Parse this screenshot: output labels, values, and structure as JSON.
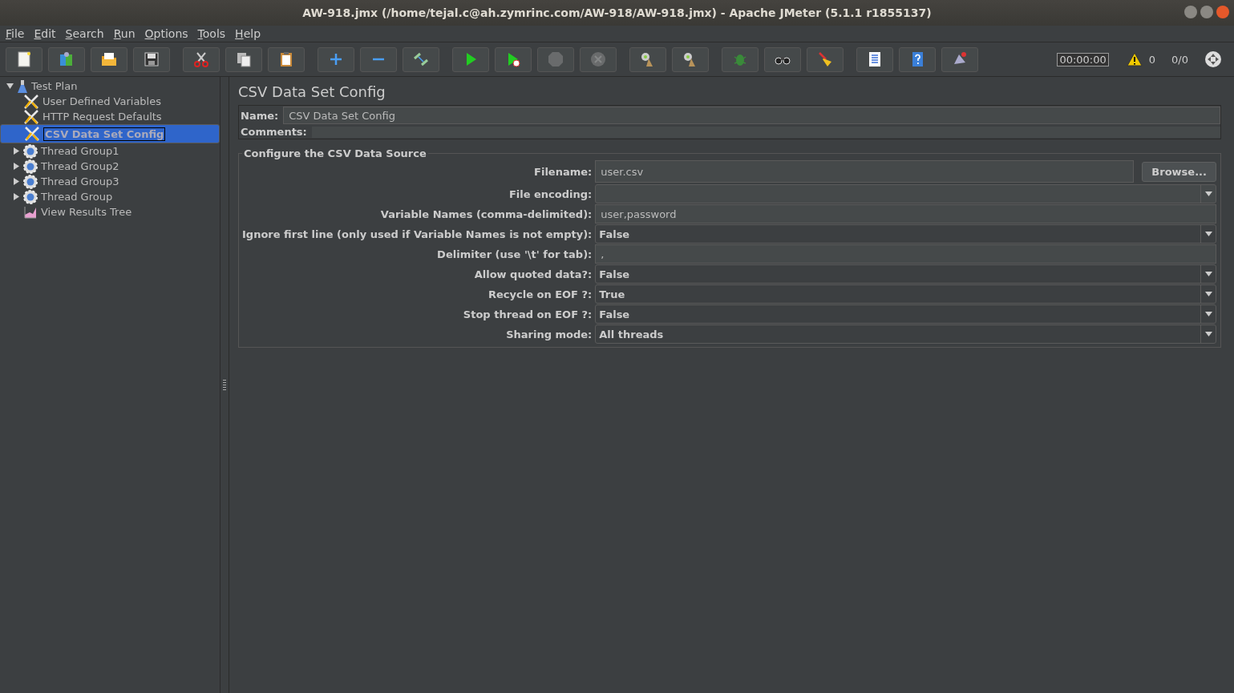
{
  "window": {
    "title": "AW-918.jmx (/home/tejal.c@ah.zymrinc.com/AW-918/AW-918.jmx) - Apache JMeter (5.1.1 r1855137)"
  },
  "menu": [
    "File",
    "Edit",
    "Search",
    "Run",
    "Options",
    "Tools",
    "Help"
  ],
  "toolbar": [
    [
      {
        "kind": "new",
        "disabled": false
      },
      {
        "kind": "templates",
        "disabled": false
      },
      {
        "kind": "open",
        "disabled": false
      },
      {
        "kind": "save",
        "disabled": false
      }
    ],
    [
      {
        "kind": "cut",
        "disabled": false
      },
      {
        "kind": "copy",
        "disabled": false
      },
      {
        "kind": "paste",
        "disabled": false
      }
    ],
    [
      {
        "kind": "plus",
        "disabled": false
      },
      {
        "kind": "minus",
        "disabled": false
      },
      {
        "kind": "toggle",
        "disabled": false
      }
    ],
    [
      {
        "kind": "start",
        "disabled": false
      },
      {
        "kind": "start-nopause",
        "disabled": false
      },
      {
        "kind": "stop",
        "disabled": true
      },
      {
        "kind": "shutdown",
        "disabled": true
      }
    ],
    [
      {
        "kind": "clear",
        "disabled": false
      },
      {
        "kind": "clear-all",
        "disabled": false
      }
    ],
    [
      {
        "kind": "bug",
        "disabled": false
      },
      {
        "kind": "binoculars",
        "disabled": false
      },
      {
        "kind": "broom",
        "disabled": false
      }
    ],
    [
      {
        "kind": "list",
        "disabled": false
      },
      {
        "kind": "help",
        "disabled": false
      },
      {
        "kind": "remote",
        "disabled": false
      }
    ]
  ],
  "status": {
    "timer": "00:00:00",
    "warnings": "0",
    "threads": "0/0"
  },
  "tree": [
    {
      "label": "Test Plan",
      "kind": "plan",
      "expanded": true,
      "selected": false,
      "children": [
        {
          "label": "User Defined Variables",
          "kind": "config",
          "selected": false
        },
        {
          "label": "HTTP Request Defaults",
          "kind": "config",
          "selected": false
        },
        {
          "label": "CSV Data Set Config",
          "kind": "config",
          "selected": true
        },
        {
          "label": "Thread Group1",
          "kind": "threads",
          "expanded": false,
          "selected": false
        },
        {
          "label": "Thread Group2",
          "kind": "threads",
          "expanded": false,
          "selected": false
        },
        {
          "label": "Thread Group3",
          "kind": "threads",
          "expanded": false,
          "selected": false
        },
        {
          "label": "Thread Group",
          "kind": "threads",
          "expanded": false,
          "selected": false
        },
        {
          "label": "View Results Tree",
          "kind": "listener",
          "selected": false
        }
      ]
    }
  ],
  "panel": {
    "title": "CSV Data Set Config",
    "name_label": "Name:",
    "name_value": "CSV Data Set Config",
    "comments_label": "Comments:",
    "section": "Configure the CSV Data Source",
    "fields": [
      {
        "label": "Filename:",
        "kind": "file",
        "value": "user.csv",
        "button": "Browse..."
      },
      {
        "label": "File encoding:",
        "kind": "combo"
      },
      {
        "label": "Variable Names (comma-delimited):",
        "kind": "text",
        "value": "user,password"
      },
      {
        "label": "Ignore first line (only used if Variable Names is not empty):",
        "kind": "select",
        "value": "False"
      },
      {
        "label": "Delimiter (use '\\t' for tab):",
        "kind": "text",
        "value": ","
      },
      {
        "label": "Allow quoted data?:",
        "kind": "select",
        "value": "False"
      },
      {
        "label": "Recycle on EOF ?:",
        "kind": "select",
        "value": "True"
      },
      {
        "label": "Stop thread on EOF ?:",
        "kind": "select",
        "value": "False"
      },
      {
        "label": "Sharing mode:",
        "kind": "select",
        "value": "All threads"
      }
    ]
  }
}
